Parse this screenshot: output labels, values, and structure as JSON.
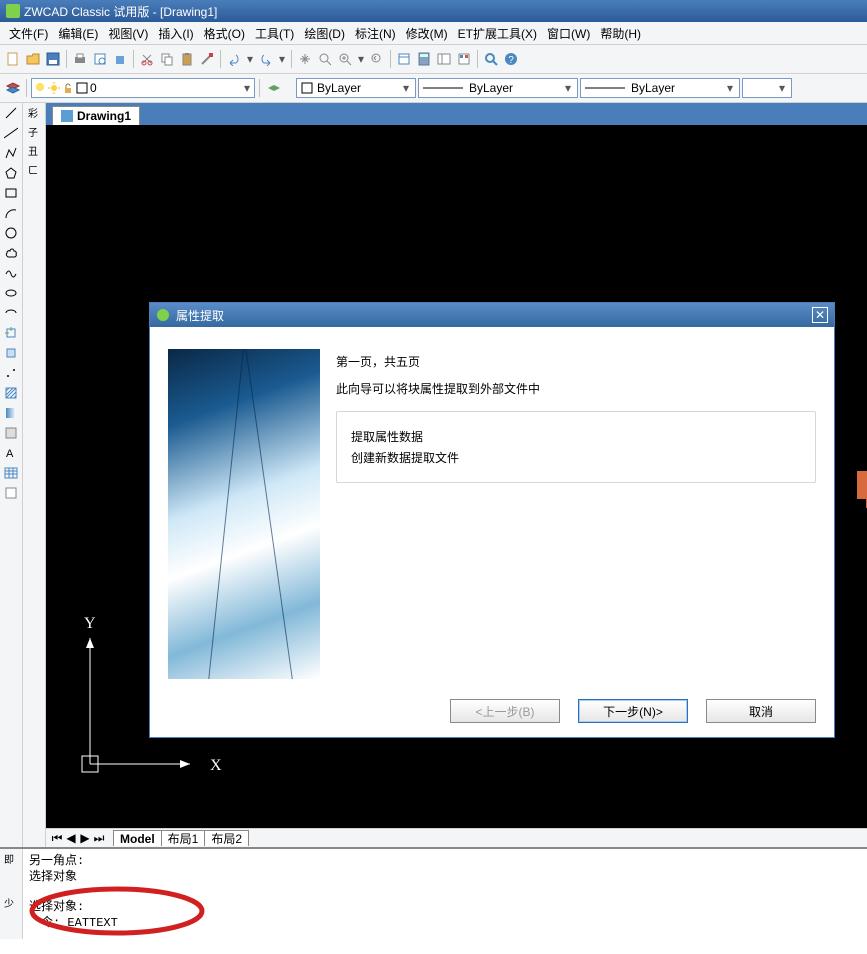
{
  "app": {
    "title": "ZWCAD Classic 试用版 - [Drawing1]"
  },
  "menu": [
    "文件(F)",
    "编辑(E)",
    "视图(V)",
    "插入(I)",
    "格式(O)",
    "工具(T)",
    "绘图(D)",
    "标注(N)",
    "修改(M)",
    "ET扩展工具(X)",
    "窗口(W)",
    "帮助(H)"
  ],
  "layer": {
    "name": "0"
  },
  "props": {
    "color": "ByLayer",
    "ltype": "ByLayer",
    "lweight": "ByLayer"
  },
  "doc_tab": "Drawing1",
  "wizard": {
    "title": "属性提取",
    "page": "第一页，共五页",
    "desc": "此向导可以将块属性提取到外部文件中",
    "opt1": "提取属性数据",
    "opt2": "创建新数据提取文件",
    "back": "<上一步(B)",
    "next": "下一步(N)>",
    "cancel": "取消"
  },
  "tabs": {
    "model": "Model",
    "l1": "布局1",
    "l2": "布局2"
  },
  "cmd": {
    "l1": "另一角点:",
    "l2": "选择对象",
    "l3": "选择对象:",
    "l4": "令: EATTEXT"
  },
  "ucs": {
    "y": "Y",
    "x": "X"
  }
}
